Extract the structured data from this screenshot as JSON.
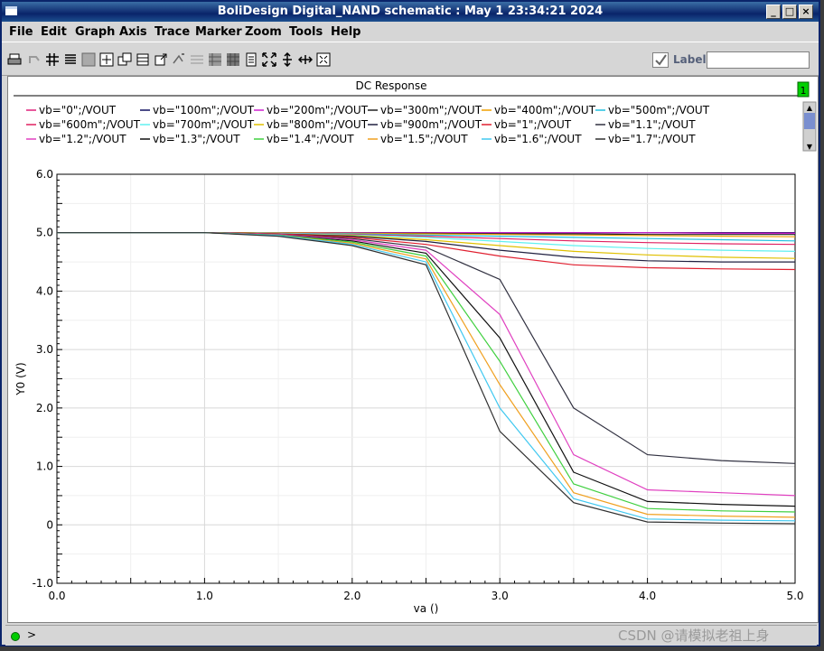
{
  "window": {
    "title": "BoliDesign Digital_NAND schematic : May  1 23:34:21 2024",
    "buttons": {
      "minimize": "_",
      "maximize": "□",
      "close": "×"
    }
  },
  "menubar": [
    "File",
    "Edit",
    "Graph",
    "Axis",
    "Trace",
    "Marker",
    "Zoom",
    "Tools",
    "Help"
  ],
  "toolbar": {
    "icons": [
      "print-icon",
      "undo-icon",
      "grid-icon",
      "strip-icon",
      "blank-icon",
      "zoom-fit-icon",
      "copy-icon",
      "layout-icon",
      "export-icon",
      "annotate-icon",
      "table-icon",
      "table-alt-icon",
      "table-dark-icon",
      "calc-icon",
      "fit-all-icon",
      "pan-vertical-icon",
      "pan-horizontal-icon",
      "zoom-box-icon"
    ],
    "label_checked": true,
    "label_text": "Label",
    "label_value": ""
  },
  "plot": {
    "header": "DC Response",
    "subwindow": "1"
  },
  "status": {
    "prompt": ">"
  },
  "watermark": "CSDN @请模拟老祖上身",
  "chart_data": {
    "type": "line",
    "title": "DC Response",
    "xlabel": "va ()",
    "ylabel": "Y0 (V)",
    "xlim": [
      0,
      5
    ],
    "ylim": [
      -1,
      6
    ],
    "xticks": [
      "0.0",
      "1.0",
      "2.0",
      "3.0",
      "4.0",
      "5.0"
    ],
    "yticks": [
      "-1.0",
      "0",
      "1.0",
      "2.0",
      "3.0",
      "4.0",
      "5.0",
      "6.0"
    ],
    "grid": true,
    "legend_position": "top",
    "series": [
      {
        "name": "vb=\"0\";/VOUT",
        "color": "#e0207a",
        "x": [
          0,
          1,
          1.5,
          2,
          2.5,
          3,
          3.5,
          4,
          4.5,
          5
        ],
        "y": [
          5,
          5,
          5,
          5,
          5,
          5,
          5,
          5,
          5,
          5
        ]
      },
      {
        "name": "vb=\"100m\";/VOUT",
        "color": "#101060",
        "x": [
          0,
          1,
          1.5,
          2,
          2.5,
          3,
          3.5,
          4,
          4.5,
          5
        ],
        "y": [
          5,
          5,
          5,
          5,
          5,
          5,
          5,
          5,
          5,
          5
        ]
      },
      {
        "name": "vb=\"200m\";/VOUT",
        "color": "#d020d0",
        "x": [
          0,
          1,
          1.5,
          2,
          2.5,
          3,
          3.5,
          4,
          4.5,
          5
        ],
        "y": [
          5,
          5,
          5,
          5,
          5,
          5,
          5,
          5,
          4.99,
          4.99
        ]
      },
      {
        "name": "vb=\"300m\";/VOUT",
        "color": "#202020",
        "x": [
          0,
          1,
          1.5,
          2,
          2.5,
          3,
          3.5,
          4,
          4.5,
          5
        ],
        "y": [
          5,
          5,
          5,
          4.99,
          4.99,
          4.98,
          4.98,
          4.97,
          4.97,
          4.97
        ]
      },
      {
        "name": "vb=\"400m\";/VOUT",
        "color": "#f0a000",
        "x": [
          0,
          1,
          1.5,
          2,
          2.5,
          3,
          3.5,
          4,
          4.5,
          5
        ],
        "y": [
          5,
          5,
          5,
          4.99,
          4.98,
          4.97,
          4.96,
          4.95,
          4.94,
          4.93
        ]
      },
      {
        "name": "vb=\"500m\";/VOUT",
        "color": "#20c0e0",
        "x": [
          0,
          1,
          1.5,
          2,
          2.5,
          3,
          3.5,
          4,
          4.5,
          5
        ],
        "y": [
          5,
          5,
          4.99,
          4.98,
          4.96,
          4.94,
          4.92,
          4.9,
          4.88,
          4.86
        ]
      },
      {
        "name": "vb=\"600m\";/VOUT",
        "color": "#e02060",
        "x": [
          0,
          1,
          1.5,
          2,
          2.5,
          3,
          3.5,
          4,
          4.5,
          5
        ],
        "y": [
          5,
          5,
          4.99,
          4.97,
          4.94,
          4.9,
          4.86,
          4.83,
          4.81,
          4.8
        ]
      },
      {
        "name": "vb=\"700m\";/VOUT",
        "color": "#60f0f0",
        "x": [
          0,
          1,
          1.5,
          2,
          2.5,
          3,
          3.5,
          4,
          4.5,
          5
        ],
        "y": [
          5,
          5,
          4.99,
          4.96,
          4.92,
          4.85,
          4.78,
          4.73,
          4.7,
          4.68
        ]
      },
      {
        "name": "vb=\"800m\";/VOUT",
        "color": "#e0c000",
        "x": [
          0,
          1,
          1.5,
          2,
          2.5,
          3,
          3.5,
          4,
          4.5,
          5
        ],
        "y": [
          5,
          5,
          4.98,
          4.95,
          4.88,
          4.78,
          4.68,
          4.62,
          4.58,
          4.56
        ]
      },
      {
        "name": "vb=\"900m\";/VOUT",
        "color": "#202040",
        "x": [
          0,
          1,
          1.5,
          2,
          2.5,
          3,
          3.5,
          4,
          4.5,
          5
        ],
        "y": [
          5,
          5,
          4.98,
          4.94,
          4.85,
          4.7,
          4.58,
          4.52,
          4.5,
          4.5
        ]
      },
      {
        "name": "vb=\"1\";/VOUT",
        "color": "#e02030",
        "x": [
          0,
          1,
          1.5,
          2,
          2.5,
          3,
          3.5,
          4,
          4.5,
          5
        ],
        "y": [
          5,
          5,
          4.98,
          4.92,
          4.8,
          4.6,
          4.45,
          4.4,
          4.38,
          4.37
        ]
      },
      {
        "name": "vb=\"1.1\";/VOUT",
        "color": "#303040",
        "x": [
          0,
          1,
          1.5,
          2,
          2.5,
          3,
          3.5,
          4,
          4.5,
          5
        ],
        "y": [
          5,
          5,
          4.97,
          4.9,
          4.75,
          4.2,
          2.0,
          1.2,
          1.1,
          1.05
        ]
      },
      {
        "name": "vb=\"1.2\";/VOUT",
        "color": "#e040c0",
        "x": [
          0,
          1,
          1.5,
          2,
          2.5,
          3,
          3.5,
          4,
          4.5,
          5
        ],
        "y": [
          5,
          5,
          4.97,
          4.88,
          4.7,
          3.6,
          1.2,
          0.6,
          0.55,
          0.5
        ]
      },
      {
        "name": "vb=\"1.3\";/VOUT",
        "color": "#101010",
        "x": [
          0,
          1,
          1.5,
          2,
          2.5,
          3,
          3.5,
          4,
          4.5,
          5
        ],
        "y": [
          5,
          5,
          4.96,
          4.86,
          4.65,
          3.2,
          0.9,
          0.4,
          0.35,
          0.32
        ]
      },
      {
        "name": "vb=\"1.4\";/VOUT",
        "color": "#40d040",
        "x": [
          0,
          1,
          1.5,
          2,
          2.5,
          3,
          3.5,
          4,
          4.5,
          5
        ],
        "y": [
          5,
          5,
          4.96,
          4.84,
          4.6,
          2.8,
          0.7,
          0.28,
          0.24,
          0.22
        ]
      },
      {
        "name": "vb=\"1.5\";/VOUT",
        "color": "#f0a020",
        "x": [
          0,
          1,
          1.5,
          2,
          2.5,
          3,
          3.5,
          4,
          4.5,
          5
        ],
        "y": [
          5,
          5,
          4.95,
          4.82,
          4.55,
          2.4,
          0.55,
          0.18,
          0.15,
          0.13
        ]
      },
      {
        "name": "vb=\"1.6\";/VOUT",
        "color": "#40c8f0",
        "x": [
          0,
          1,
          1.5,
          2,
          2.5,
          3,
          3.5,
          4,
          4.5,
          5
        ],
        "y": [
          5,
          5,
          4.95,
          4.8,
          4.5,
          2.0,
          0.45,
          0.1,
          0.08,
          0.07
        ]
      },
      {
        "name": "vb=\"1.7\";/VOUT",
        "color": "#303030",
        "x": [
          0,
          1,
          1.5,
          2,
          2.5,
          3,
          3.5,
          4,
          4.5,
          5
        ],
        "y": [
          5,
          5,
          4.94,
          4.78,
          4.45,
          1.6,
          0.38,
          0.05,
          0.03,
          0.02
        ]
      }
    ]
  }
}
